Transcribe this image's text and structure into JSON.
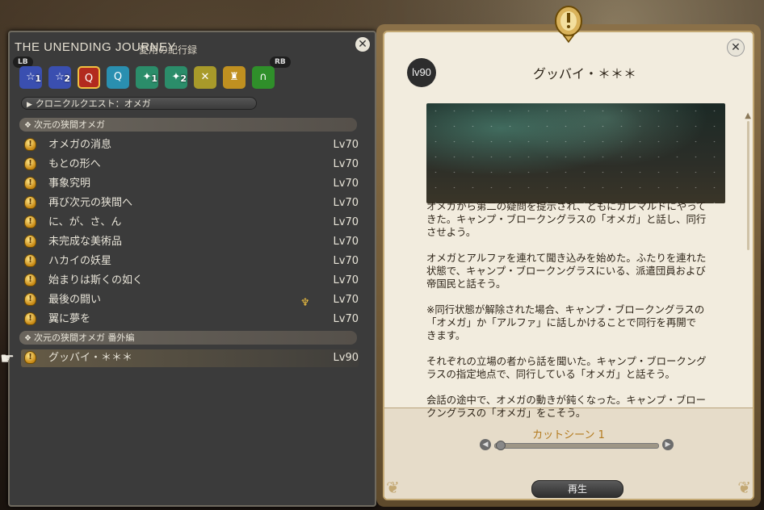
{
  "left_panel": {
    "title": "THE UNENDING JOURNEY",
    "subtitle": "愛用の紀行録",
    "shoulder_left": "LB",
    "shoulder_right": "RB",
    "tabs": [
      {
        "icon": "quest-tab-1-icon",
        "badge": "1",
        "color": "#3a4fb0"
      },
      {
        "icon": "quest-tab-2-icon",
        "badge": "2",
        "color": "#3a4fb0"
      },
      {
        "icon": "quest-tab-3-icon",
        "badge": "",
        "color": "#b22a1e"
      },
      {
        "icon": "quest-tab-4-icon",
        "badge": "",
        "color": "#2a8fb0"
      },
      {
        "icon": "quest-tab-5-icon",
        "badge": "1",
        "color": "#2b8d6a"
      },
      {
        "icon": "quest-tab-6-icon",
        "badge": "2",
        "color": "#2b8d6a"
      },
      {
        "icon": "quest-tab-7-icon",
        "badge": "",
        "color": "#a89a2a"
      },
      {
        "icon": "quest-tab-8-icon",
        "badge": "",
        "color": "#c09020"
      },
      {
        "icon": "quest-tab-9-icon",
        "badge": "",
        "color": "#2f8f2a"
      }
    ],
    "category_dropdown": "クロニクルクエスト：オメガ",
    "group1": "次元の狭間オメガ",
    "quests": [
      {
        "name": "オメガの消息",
        "level": "Lv70"
      },
      {
        "name": "もとの形へ",
        "level": "Lv70"
      },
      {
        "name": "事象究明",
        "level": "Lv70"
      },
      {
        "name": "再び次元の狭間へ",
        "level": "Lv70"
      },
      {
        "name": "に、が、さ、ん",
        "level": "Lv70"
      },
      {
        "name": "未完成な美術品",
        "level": "Lv70"
      },
      {
        "name": "ハカイの妖星",
        "level": "Lv70"
      },
      {
        "name": "始まりは斯くの如く",
        "level": "Lv70"
      },
      {
        "name": "最後の闘い",
        "level": "Lv70"
      },
      {
        "name": "翼に夢を",
        "level": "Lv70"
      }
    ],
    "group2": "次元の狭間オメガ 番外編",
    "selected_quest": {
      "name": "グッバイ・＊＊＊",
      "level": "Lv90"
    }
  },
  "right_panel": {
    "level_badge": "lv90",
    "title": "グッバイ・＊＊＊",
    "description": [
      "オメガから第二の疑問を提示され、ともにガレマルドにやって\nきた。キャンプ・ブロークングラスの「オメガ」と話し、同行\nさせよう。",
      "オメガとアルファを連れて聞き込みを始めた。ふたりを連れた\n状態で、キャンプ・ブロークングラスにいる、派遣団員および\n帝国民と話そう。",
      "※同行状態が解除された場合、キャンプ・ブロークングラスの\n「オメガ」か「アルファ」に話しかけることで同行を再開で\nきます。",
      "それぞれの立場の者から話を聞いた。キャンプ・ブロークング\nラスの指定地点で、同行している「オメガ」と話そう。",
      "会話の途中で、オメガの動きが鈍くなった。キャンプ・ブロー\nクングラスの「オメガ」をこそう。"
    ],
    "cutscene_label": "カットシーン 1",
    "play_label": "再生"
  }
}
